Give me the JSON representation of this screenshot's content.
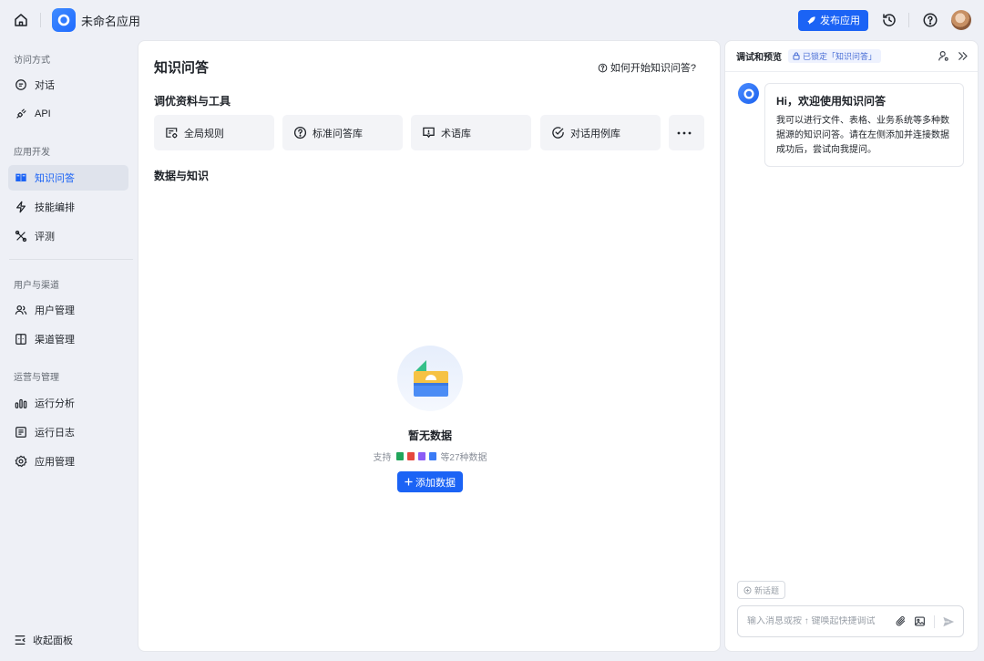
{
  "app": {
    "name": "未命名应用"
  },
  "topbar": {
    "publish_label": "发布应用"
  },
  "sidebar": {
    "sections": [
      {
        "title": "访问方式"
      },
      {
        "title": "应用开发"
      },
      {
        "title": "用户与渠道"
      },
      {
        "title": "运营与管理"
      }
    ],
    "items": [
      {
        "label": "对话",
        "icon": "chat-icon"
      },
      {
        "label": "API",
        "icon": "api-icon"
      },
      {
        "label": "知识问答",
        "icon": "book-icon",
        "active": true
      },
      {
        "label": "技能编排",
        "icon": "lightning-icon"
      },
      {
        "label": "评测",
        "icon": "tools-icon"
      },
      {
        "label": "用户管理",
        "icon": "users-icon"
      },
      {
        "label": "渠道管理",
        "icon": "channel-icon"
      },
      {
        "label": "运行分析",
        "icon": "bar-chart-icon"
      },
      {
        "label": "运行日志",
        "icon": "log-icon"
      },
      {
        "label": "应用管理",
        "icon": "gear-icon"
      }
    ],
    "collapse_label": "收起面板"
  },
  "main": {
    "title": "知识问答",
    "help_link": "如何开始知识问答?",
    "tools_section_title": "调优资料与工具",
    "tools": [
      {
        "label": "全局规则",
        "icon": "rules-icon"
      },
      {
        "label": "标准问答库",
        "icon": "question-icon"
      },
      {
        "label": "术语库",
        "icon": "glossary-icon"
      },
      {
        "label": "对话用例库",
        "icon": "check-circle-icon"
      }
    ],
    "data_section_title": "数据与知识",
    "empty": {
      "title": "暂无数据",
      "support_prefix": "支持",
      "support_suffix": "等27种数据",
      "file_colors": [
        "#22a55b",
        "#e5483f",
        "#8b5cf6",
        "#3b7bf6"
      ],
      "add_label": "添加数据"
    }
  },
  "preview": {
    "title": "调试和预览",
    "lock_badge": "已锁定「知识问答」",
    "greeting_title": "Hi，欢迎使用知识问答",
    "greeting_body": "我可以进行文件、表格、业务系统等多种数据源的知识问答。请在左侧添加并连接数据成功后，尝试向我提问。",
    "new_topic_label": "新话题",
    "input_placeholder": "输入消息或按 ↑ 键唤起快捷调试"
  },
  "colors": {
    "accent": "#1b63f5",
    "background": "#eef0f6"
  }
}
